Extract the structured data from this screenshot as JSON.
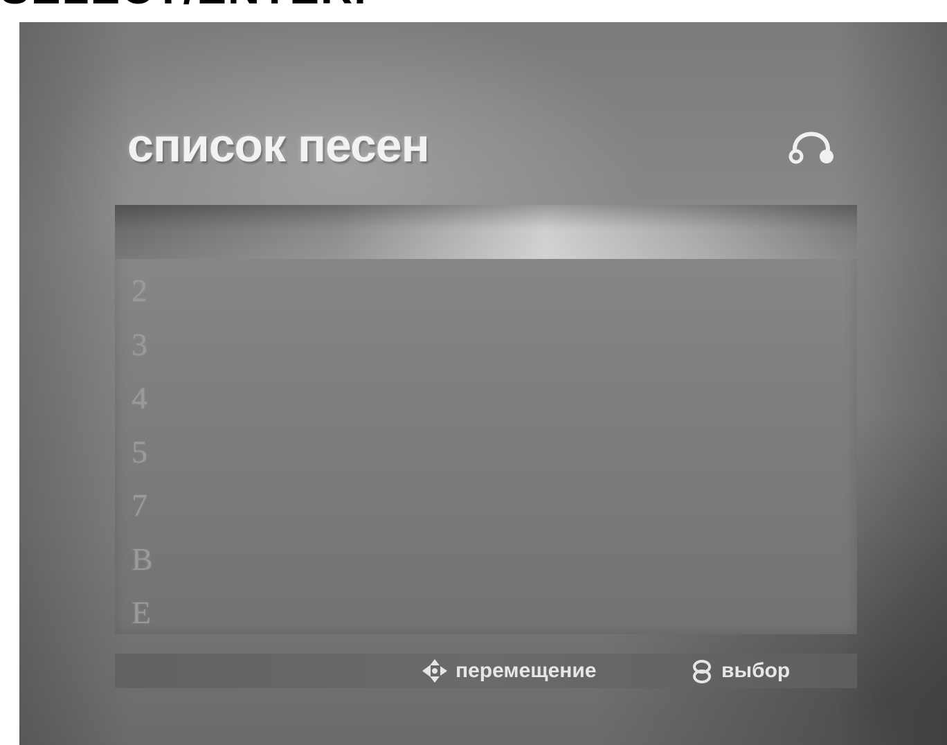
{
  "top_caption": "SELECT/ENTER.",
  "screen": {
    "title": "список песен",
    "icons": {
      "title_icon": "headphones-icon",
      "move_icon": "navigation-arrows-icon",
      "select_icon": "enter-button-icon"
    },
    "tracks": [
      "2",
      "3",
      "4",
      "5",
      "7",
      "B",
      "E"
    ],
    "hints": {
      "move_label": "перемещение",
      "select_label": "выбор"
    }
  }
}
